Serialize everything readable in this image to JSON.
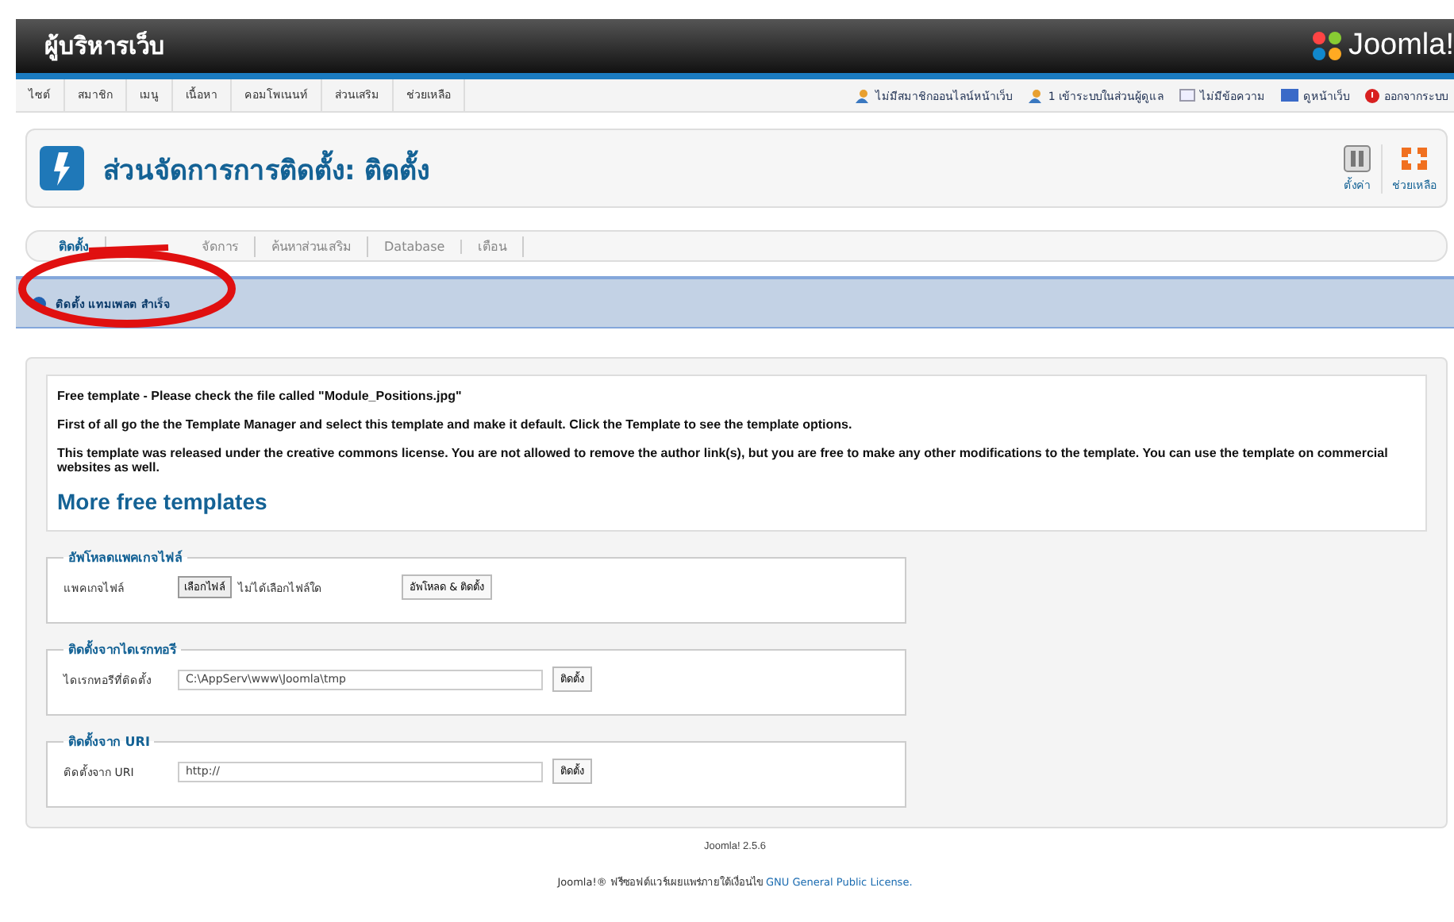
{
  "header": {
    "title": "ผู้บริหารเว็บ",
    "logo_text": "Joomla!"
  },
  "menu": [
    "ไซต์",
    "สมาชิก",
    "เมนู",
    "เนื้อหา",
    "คอมโพเนนท์",
    "ส่วนเสริม",
    "ช่วยเหลือ"
  ],
  "status": [
    {
      "kind": "users",
      "text": "ไม่มีสมาชิกออนไลน์หน้าเว็บ"
    },
    {
      "kind": "users",
      "text": "1 เข้าระบบในส่วนผู้ดูแล"
    },
    {
      "kind": "mail",
      "text": "ไม่มีข้อความ"
    },
    {
      "kind": "view",
      "text": "ดูหน้าเว็บ"
    },
    {
      "kind": "logout",
      "text": "ออกจากระบบ"
    }
  ],
  "page_title": "ส่วนจัดการการติดตั้ง: ติดตั้ง",
  "toolbar": [
    {
      "kind": "options",
      "label": "ตั้งค่า"
    },
    {
      "kind": "help",
      "label": "ช่วยเหลือ"
    }
  ],
  "tabs": [
    {
      "label": "ติดตั้ง",
      "selected": true
    },
    {
      "label": "จัดการ",
      "selected": false
    },
    {
      "label": "ค้นหาส่วนเสริม",
      "selected": false
    },
    {
      "label": "Database",
      "selected": false
    },
    {
      "label": "เตือน",
      "selected": false
    }
  ],
  "message": "ติดตั้ง แทมเพลต สำเร็จ",
  "description": [
    "Free template - Please check the file called \"Module_Positions.jpg\"",
    "First of all go the the Template Manager and select this template and make it default. Click the Template to see the template options.",
    "This template was released under the creative commons license. You are not allowed to remove the author link(s), but you are free to make any other modifications to the template. You can use the template on commercial websites as well."
  ],
  "more_link": "More free templates",
  "fieldsets": [
    {
      "kind": "file",
      "legend": "อัพโหลดแพคเกจไฟล์",
      "label": "แพคเกจไฟล์",
      "choose": "เลือกไฟล์",
      "value": "ไม่ได้เลือกไฟล์ใด",
      "button": "อัพโหลด & ติดตั้ง"
    },
    {
      "kind": "text",
      "legend": "ติดตั้งจากไดเรกทอรี",
      "label": "ไดเรกทอรีที่ติดตั้ง",
      "value": "C:\\AppServ\\www\\Joomla\\tmp",
      "button": "ติดตั้ง"
    },
    {
      "kind": "text",
      "legend": "ติดตั้งจาก URI",
      "label": "ติดตั้งจาก URI",
      "value": "http://",
      "button": "ติดตั้ง"
    }
  ],
  "footer": {
    "version": "Joomla! 2.5.6",
    "license": "Joomla!® ฟรีซอฟต์แวร์เผยแพร่ภายใต้เงื่อนไข",
    "license_link": "GNU General Public License."
  }
}
